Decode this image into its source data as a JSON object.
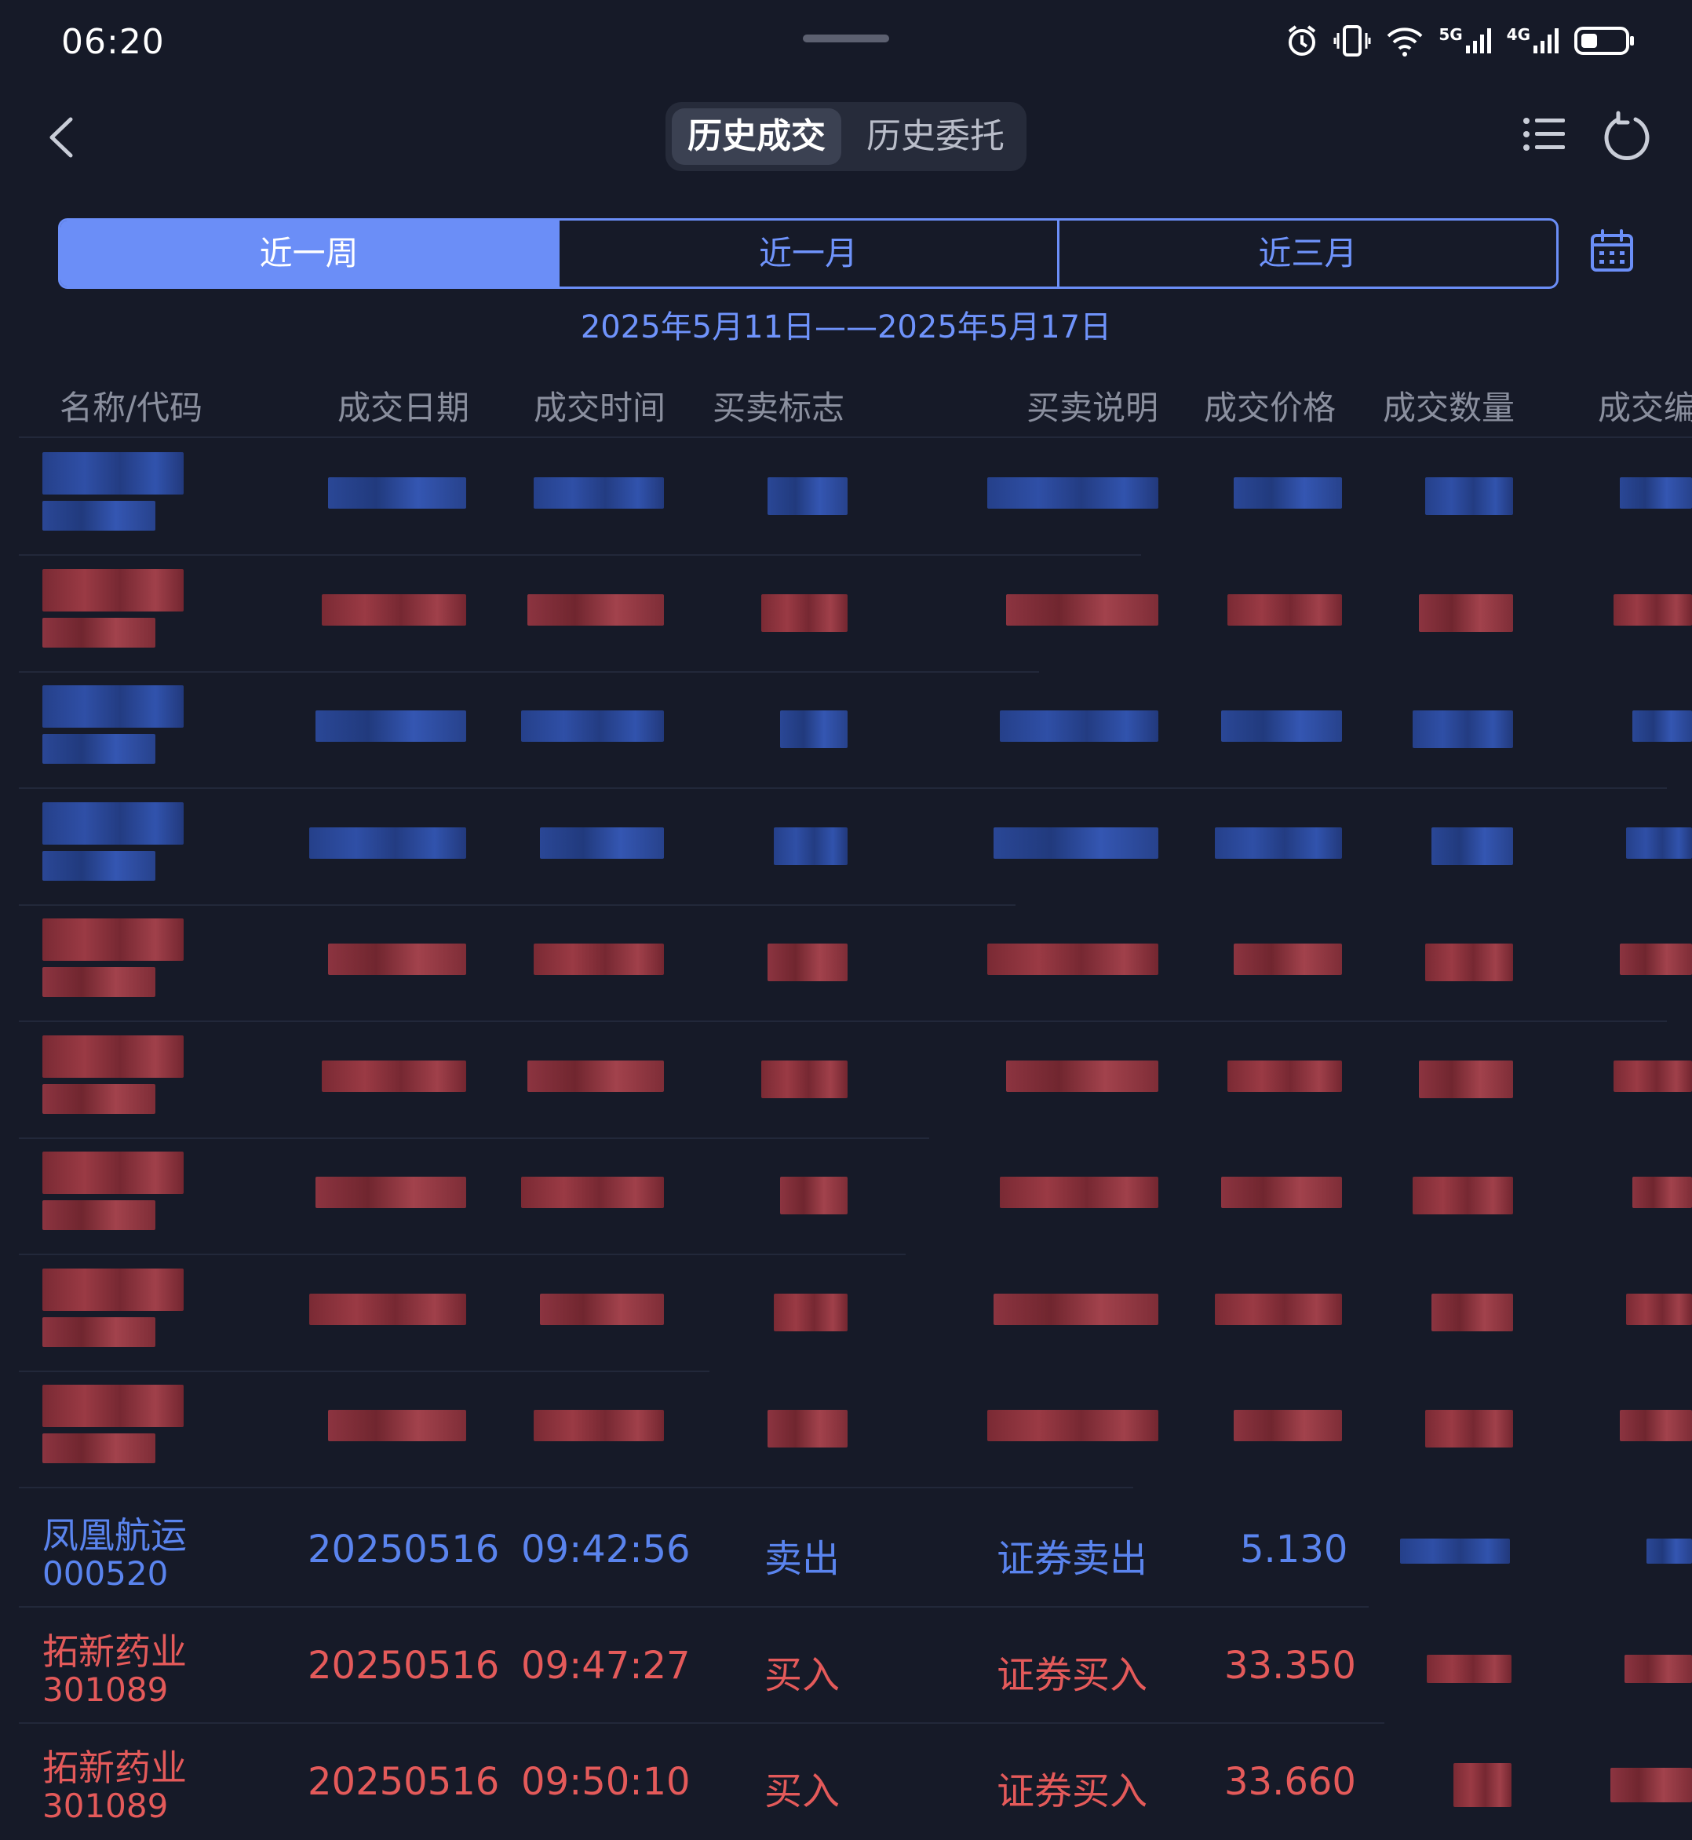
{
  "status_bar": {
    "time": "06:20",
    "network_5g": "5G",
    "network_4g": "4G"
  },
  "header": {
    "tabs": [
      {
        "label": "历史成交",
        "active": true
      },
      {
        "label": "历史委托",
        "active": false
      }
    ]
  },
  "period": {
    "options": [
      {
        "label": "近一周",
        "active": true
      },
      {
        "label": "近一月",
        "active": false
      },
      {
        "label": "近三月",
        "active": false
      }
    ],
    "date_range": "2025年5月11日——2025年5月17日"
  },
  "table": {
    "columns": [
      "名称/代码",
      "成交日期",
      "成交时间",
      "买卖标志",
      "买卖说明",
      "成交价格",
      "成交数量",
      "成交编"
    ],
    "visible_rows": [
      {
        "name": "凤凰航运",
        "code": "000520",
        "date": "20250516",
        "time": "09:42:56",
        "side": "卖出",
        "desc": "证券卖出",
        "price": "5.130",
        "type": "sell"
      },
      {
        "name": "拓新药业",
        "code": "301089",
        "date": "20250516",
        "time": "09:47:27",
        "side": "买入",
        "desc": "证券买入",
        "price": "33.350",
        "type": "buy"
      },
      {
        "name": "拓新药业",
        "code": "301089",
        "date": "20250516",
        "time": "09:50:10",
        "side": "买入",
        "desc": "证券买入",
        "price": "33.660",
        "type": "buy"
      }
    ],
    "blurred_row_types": [
      "sell",
      "buy",
      "sell",
      "sell",
      "buy",
      "buy",
      "buy",
      "buy",
      "buy"
    ]
  },
  "colors": {
    "accent": "#6b8ef7",
    "buy": "#e45a5a",
    "sell": "#5a84ee",
    "background": "#161a28"
  }
}
